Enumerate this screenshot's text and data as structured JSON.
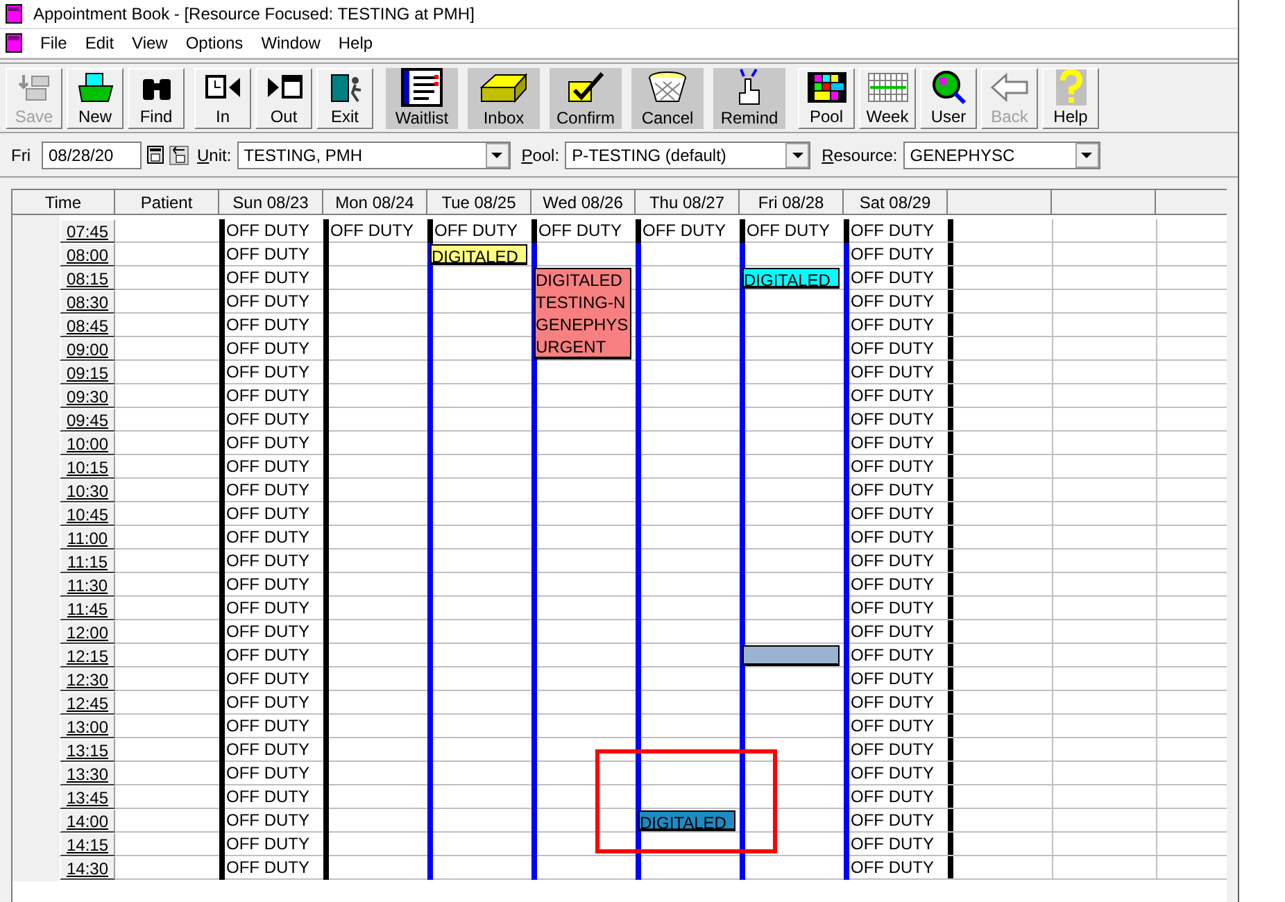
{
  "window": {
    "title": "Appointment Book - [Resource Focused:  TESTING at PMH]"
  },
  "menu": [
    "File",
    "Edit",
    "View",
    "Options",
    "Window",
    "Help"
  ],
  "toolbar": [
    [
      {
        "label": "Save",
        "disabled": true,
        "kind": "raised"
      },
      {
        "label": "New",
        "disabled": false,
        "kind": "raised"
      },
      {
        "label": "Find",
        "disabled": false,
        "kind": "raised"
      }
    ],
    [
      {
        "label": "In",
        "disabled": false,
        "kind": "raised"
      },
      {
        "label": "Out",
        "disabled": false,
        "kind": "raised"
      },
      {
        "label": "Exit",
        "disabled": false,
        "kind": "raised"
      }
    ],
    [
      {
        "label": "Waitlist",
        "disabled": false,
        "kind": "flat"
      },
      {
        "label": "Inbox",
        "disabled": false,
        "kind": "flat"
      },
      {
        "label": "Confirm",
        "disabled": false,
        "kind": "flat"
      },
      {
        "label": "Cancel",
        "disabled": false,
        "kind": "flat"
      },
      {
        "label": "Remind",
        "disabled": false,
        "kind": "flat"
      }
    ],
    [
      {
        "label": "Pool",
        "disabled": false,
        "kind": "raised"
      },
      {
        "label": "Week",
        "disabled": false,
        "kind": "raised"
      },
      {
        "label": "User",
        "disabled": false,
        "kind": "raised"
      },
      {
        "label": "Back",
        "disabled": true,
        "kind": "raised"
      },
      {
        "label": "Help",
        "disabled": false,
        "kind": "raised"
      }
    ]
  ],
  "filters": {
    "day": "Fri",
    "date": "08/28/20",
    "unit": {
      "label": "Unit:",
      "value": "TESTING, PMH"
    },
    "pool": {
      "label": "Pool:",
      "value": "P-TESTING (default)"
    },
    "resource": {
      "label": "Resource:",
      "value": "GENEPHYSC"
    }
  },
  "grid": {
    "time_header": "Time",
    "patient_header": "Patient",
    "days": [
      {
        "label": "Sun 08/23",
        "color": "#000000"
      },
      {
        "label": "Mon 08/24",
        "color": "#000000"
      },
      {
        "label": "Tue 08/25",
        "color": "#0000ff"
      },
      {
        "label": "Wed 08/26",
        "color": "#0000ff"
      },
      {
        "label": "Thu 08/27",
        "color": "#0000ff"
      },
      {
        "label": "Fri 08/28",
        "color": "#0000ff"
      },
      {
        "label": "Sat 08/29",
        "color": "#0000ff"
      }
    ],
    "rows": [
      {
        "time": "07:45",
        "cells": [
          {
            "kind": "text",
            "text": "OFF DUTY"
          },
          {
            "kind": "text",
            "text": "OFF DUTY"
          },
          {
            "kind": "text",
            "text": "OFF DUTY"
          },
          {
            "kind": "text",
            "text": "OFF DUTY"
          },
          {
            "kind": "text",
            "text": "OFF DUTY"
          },
          {
            "kind": "text",
            "text": "OFF DUTY"
          },
          {
            "kind": "text",
            "text": "OFF DUTY"
          }
        ]
      },
      {
        "time": "08:00",
        "cells": [
          {
            "kind": "text",
            "text": "OFF DUTY"
          },
          {
            "kind": "empty"
          },
          {
            "kind": "appointment",
            "lines": [
              "DIGITALED"
            ],
            "color": "#ffff80"
          },
          {
            "kind": "empty"
          },
          {
            "kind": "empty"
          },
          {
            "kind": "empty"
          },
          {
            "kind": "text",
            "text": "OFF DUTY"
          }
        ]
      },
      {
        "time": "08:15",
        "cells": [
          {
            "kind": "text",
            "text": "OFF DUTY"
          },
          {
            "kind": "empty"
          },
          {
            "kind": "empty"
          },
          {
            "kind": "appointment",
            "lines": [
              "DIGITALED",
              "TESTING-N",
              "GENEPHYS",
              "URGENT"
            ],
            "color": "#f88080"
          },
          {
            "kind": "empty"
          },
          {
            "kind": "appointment",
            "lines": [
              "DIGITALED"
            ],
            "color": "#00ffff"
          },
          {
            "kind": "text",
            "text": "OFF DUTY"
          }
        ]
      },
      {
        "time": "08:30",
        "cells": [
          {
            "kind": "text",
            "text": "OFF DUTY"
          },
          {
            "kind": "empty"
          },
          {
            "kind": "empty"
          },
          {
            "kind": "empty"
          },
          {
            "kind": "empty"
          },
          {
            "kind": "empty"
          },
          {
            "kind": "text",
            "text": "OFF DUTY"
          }
        ]
      },
      {
        "time": "08:45",
        "cells": [
          {
            "kind": "text",
            "text": "OFF DUTY"
          },
          {
            "kind": "empty"
          },
          {
            "kind": "empty"
          },
          {
            "kind": "empty"
          },
          {
            "kind": "empty"
          },
          {
            "kind": "empty"
          },
          {
            "kind": "text",
            "text": "OFF DUTY"
          }
        ]
      },
      {
        "time": "09:00",
        "cells": [
          {
            "kind": "text",
            "text": "OFF DUTY"
          },
          {
            "kind": "empty"
          },
          {
            "kind": "empty"
          },
          {
            "kind": "empty"
          },
          {
            "kind": "empty"
          },
          {
            "kind": "empty"
          },
          {
            "kind": "text",
            "text": "OFF DUTY"
          }
        ]
      },
      {
        "time": "09:15",
        "cells": [
          {
            "kind": "text",
            "text": "OFF DUTY"
          },
          {
            "kind": "empty"
          },
          {
            "kind": "empty"
          },
          {
            "kind": "empty"
          },
          {
            "kind": "empty"
          },
          {
            "kind": "empty"
          },
          {
            "kind": "text",
            "text": "OFF DUTY"
          }
        ]
      },
      {
        "time": "09:30",
        "cells": [
          {
            "kind": "text",
            "text": "OFF DUTY"
          },
          {
            "kind": "empty"
          },
          {
            "kind": "empty"
          },
          {
            "kind": "empty"
          },
          {
            "kind": "empty"
          },
          {
            "kind": "empty"
          },
          {
            "kind": "text",
            "text": "OFF DUTY"
          }
        ]
      },
      {
        "time": "09:45",
        "cells": [
          {
            "kind": "text",
            "text": "OFF DUTY"
          },
          {
            "kind": "empty"
          },
          {
            "kind": "empty"
          },
          {
            "kind": "empty"
          },
          {
            "kind": "empty"
          },
          {
            "kind": "empty"
          },
          {
            "kind": "text",
            "text": "OFF DUTY"
          }
        ]
      },
      {
        "time": "10:00",
        "cells": [
          {
            "kind": "text",
            "text": "OFF DUTY"
          },
          {
            "kind": "empty"
          },
          {
            "kind": "empty"
          },
          {
            "kind": "empty"
          },
          {
            "kind": "empty"
          },
          {
            "kind": "empty"
          },
          {
            "kind": "text",
            "text": "OFF DUTY"
          }
        ]
      },
      {
        "time": "10:15",
        "cells": [
          {
            "kind": "text",
            "text": "OFF DUTY"
          },
          {
            "kind": "empty"
          },
          {
            "kind": "empty"
          },
          {
            "kind": "empty"
          },
          {
            "kind": "empty"
          },
          {
            "kind": "empty"
          },
          {
            "kind": "text",
            "text": "OFF DUTY"
          }
        ]
      },
      {
        "time": "10:30",
        "cells": [
          {
            "kind": "text",
            "text": "OFF DUTY"
          },
          {
            "kind": "empty"
          },
          {
            "kind": "empty"
          },
          {
            "kind": "empty"
          },
          {
            "kind": "empty"
          },
          {
            "kind": "empty"
          },
          {
            "kind": "text",
            "text": "OFF DUTY"
          }
        ]
      },
      {
        "time": "10:45",
        "cells": [
          {
            "kind": "text",
            "text": "OFF DUTY"
          },
          {
            "kind": "empty"
          },
          {
            "kind": "empty"
          },
          {
            "kind": "empty"
          },
          {
            "kind": "empty"
          },
          {
            "kind": "empty"
          },
          {
            "kind": "text",
            "text": "OFF DUTY"
          }
        ]
      },
      {
        "time": "11:00",
        "cells": [
          {
            "kind": "text",
            "text": "OFF DUTY"
          },
          {
            "kind": "empty"
          },
          {
            "kind": "empty"
          },
          {
            "kind": "empty"
          },
          {
            "kind": "empty"
          },
          {
            "kind": "empty"
          },
          {
            "kind": "text",
            "text": "OFF DUTY"
          }
        ]
      },
      {
        "time": "11:15",
        "cells": [
          {
            "kind": "text",
            "text": "OFF DUTY"
          },
          {
            "kind": "empty"
          },
          {
            "kind": "empty"
          },
          {
            "kind": "empty"
          },
          {
            "kind": "empty"
          },
          {
            "kind": "empty"
          },
          {
            "kind": "text",
            "text": "OFF DUTY"
          }
        ]
      },
      {
        "time": "11:30",
        "cells": [
          {
            "kind": "text",
            "text": "OFF DUTY"
          },
          {
            "kind": "empty"
          },
          {
            "kind": "empty"
          },
          {
            "kind": "empty"
          },
          {
            "kind": "empty"
          },
          {
            "kind": "empty"
          },
          {
            "kind": "text",
            "text": "OFF DUTY"
          }
        ]
      },
      {
        "time": "11:45",
        "cells": [
          {
            "kind": "text",
            "text": "OFF DUTY"
          },
          {
            "kind": "empty"
          },
          {
            "kind": "empty"
          },
          {
            "kind": "empty"
          },
          {
            "kind": "empty"
          },
          {
            "kind": "empty"
          },
          {
            "kind": "text",
            "text": "OFF DUTY"
          }
        ]
      },
      {
        "time": "12:00",
        "cells": [
          {
            "kind": "text",
            "text": "OFF DUTY"
          },
          {
            "kind": "empty"
          },
          {
            "kind": "empty"
          },
          {
            "kind": "empty"
          },
          {
            "kind": "empty"
          },
          {
            "kind": "empty"
          },
          {
            "kind": "text",
            "text": "OFF DUTY"
          }
        ]
      },
      {
        "time": "12:15",
        "cells": [
          {
            "kind": "text",
            "text": "OFF DUTY"
          },
          {
            "kind": "empty"
          },
          {
            "kind": "empty"
          },
          {
            "kind": "empty"
          },
          {
            "kind": "empty"
          },
          {
            "kind": "block",
            "color": "#9ab4d0"
          },
          {
            "kind": "text",
            "text": "OFF DUTY"
          }
        ]
      },
      {
        "time": "12:30",
        "cells": [
          {
            "kind": "text",
            "text": "OFF DUTY"
          },
          {
            "kind": "empty"
          },
          {
            "kind": "empty"
          },
          {
            "kind": "empty"
          },
          {
            "kind": "empty"
          },
          {
            "kind": "empty"
          },
          {
            "kind": "text",
            "text": "OFF DUTY"
          }
        ]
      },
      {
        "time": "12:45",
        "cells": [
          {
            "kind": "text",
            "text": "OFF DUTY"
          },
          {
            "kind": "empty"
          },
          {
            "kind": "empty"
          },
          {
            "kind": "empty"
          },
          {
            "kind": "empty"
          },
          {
            "kind": "empty"
          },
          {
            "kind": "text",
            "text": "OFF DUTY"
          }
        ]
      },
      {
        "time": "13:00",
        "cells": [
          {
            "kind": "text",
            "text": "OFF DUTY"
          },
          {
            "kind": "empty"
          },
          {
            "kind": "empty"
          },
          {
            "kind": "empty"
          },
          {
            "kind": "empty"
          },
          {
            "kind": "empty"
          },
          {
            "kind": "text",
            "text": "OFF DUTY"
          }
        ]
      },
      {
        "time": "13:15",
        "cells": [
          {
            "kind": "text",
            "text": "OFF DUTY"
          },
          {
            "kind": "empty"
          },
          {
            "kind": "empty"
          },
          {
            "kind": "empty"
          },
          {
            "kind": "empty"
          },
          {
            "kind": "empty"
          },
          {
            "kind": "text",
            "text": "OFF DUTY"
          }
        ]
      },
      {
        "time": "13:30",
        "cells": [
          {
            "kind": "text",
            "text": "OFF DUTY"
          },
          {
            "kind": "empty"
          },
          {
            "kind": "empty"
          },
          {
            "kind": "empty"
          },
          {
            "kind": "empty",
            "highlight": {
              "color": "#ff0000"
            }
          },
          {
            "kind": "empty"
          },
          {
            "kind": "text",
            "text": "OFF DUTY"
          }
        ]
      },
      {
        "time": "13:45",
        "cells": [
          {
            "kind": "text",
            "text": "OFF DUTY"
          },
          {
            "kind": "empty"
          },
          {
            "kind": "empty"
          },
          {
            "kind": "empty"
          },
          {
            "kind": "empty"
          },
          {
            "kind": "empty"
          },
          {
            "kind": "text",
            "text": "OFF DUTY"
          }
        ]
      },
      {
        "time": "14:00",
        "cells": [
          {
            "kind": "text",
            "text": "OFF DUTY"
          },
          {
            "kind": "empty"
          },
          {
            "kind": "empty"
          },
          {
            "kind": "empty"
          },
          {
            "kind": "appointment",
            "lines": [
              "DIGITALED"
            ],
            "color": "#1e8bc3"
          },
          {
            "kind": "empty"
          },
          {
            "kind": "text",
            "text": "OFF DUTY"
          }
        ]
      },
      {
        "time": "14:15",
        "cells": [
          {
            "kind": "text",
            "text": "OFF DUTY"
          },
          {
            "kind": "empty"
          },
          {
            "kind": "empty"
          },
          {
            "kind": "empty"
          },
          {
            "kind": "empty"
          },
          {
            "kind": "empty"
          },
          {
            "kind": "text",
            "text": "OFF DUTY"
          }
        ]
      },
      {
        "time": "14:30",
        "cells": [
          {
            "kind": "text",
            "text": "OFF DUTY"
          },
          {
            "kind": "empty"
          },
          {
            "kind": "empty"
          },
          {
            "kind": "empty"
          },
          {
            "kind": "empty"
          },
          {
            "kind": "empty"
          },
          {
            "kind": "text",
            "text": "OFF DUTY"
          }
        ]
      }
    ]
  }
}
